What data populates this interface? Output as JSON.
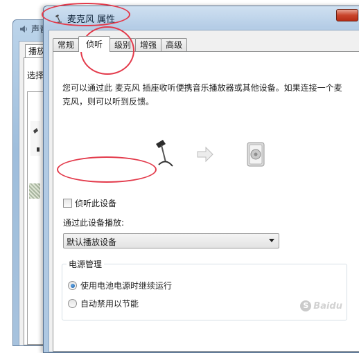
{
  "background_window": {
    "title": "声音",
    "tab": "播放",
    "label": "选择"
  },
  "dialog": {
    "title": "麦克风 属性",
    "tabs": [
      {
        "label": "常规",
        "active": false
      },
      {
        "label": "侦听",
        "active": true
      },
      {
        "label": "级别",
        "active": false
      },
      {
        "label": "增强",
        "active": false
      },
      {
        "label": "高级",
        "active": false
      }
    ],
    "description": "您可以通过此 麦克风 插座收听便携音乐播放器或其他设备。如果连接一个麦克风，则可以听到反馈。",
    "listen_checkbox": {
      "label": "侦听此设备",
      "checked": false
    },
    "playback_label": "通过此设备播放:",
    "playback_select_value": "默认播放设备",
    "power": {
      "legend": "电源管理",
      "options": [
        {
          "label": "使用电池电源时继续运行",
          "selected": true
        },
        {
          "label": "自动禁用以节能",
          "selected": false
        }
      ]
    }
  },
  "icons": [
    "speaker-icon",
    "microphone-icon",
    "arrow-right-icon",
    "speaker-device-icon"
  ],
  "colors": {
    "annotation": "#e33a4b",
    "selection": "#1d5fa8"
  }
}
